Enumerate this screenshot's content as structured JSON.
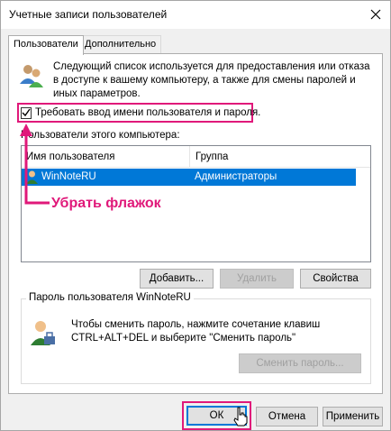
{
  "window": {
    "title": "Учетные записи пользователей"
  },
  "tabs": [
    {
      "label": "Пользователи",
      "active": true
    },
    {
      "label": "Дополнительно",
      "active": false
    }
  ],
  "users_tab": {
    "description": "Следующий список используется для предоставления или отказа в доступе к вашему компьютеру, а также для смены паролей и иных параметров.",
    "require_login_checkbox": {
      "label": "Требовать ввод имени пользователя и пароля.",
      "checked": true
    },
    "list_label": "Пользователи этого компьютера:",
    "columns": [
      "Имя пользователя",
      "Группа"
    ],
    "rows": [
      {
        "name": "WinNoteRU",
        "group": "Администраторы",
        "selected": true
      }
    ],
    "buttons": {
      "add": "Добавить...",
      "remove": "Удалить",
      "properties": "Свойства"
    },
    "password_group": {
      "legend": "Пароль пользователя WinNoteRU",
      "text": "Чтобы сменить пароль, нажмите сочетание клавиш CTRL+ALT+DEL и выберите \"Сменить пароль\"",
      "change_button": "Сменить пароль..."
    }
  },
  "annotation": {
    "callout": "Убрать флажок",
    "color": "#e0197a"
  },
  "dialog_buttons": {
    "ok": "ОК",
    "cancel": "Отмена",
    "apply": "Применить"
  },
  "colors": {
    "selection": "#0078d7",
    "highlight": "#e0197a"
  }
}
